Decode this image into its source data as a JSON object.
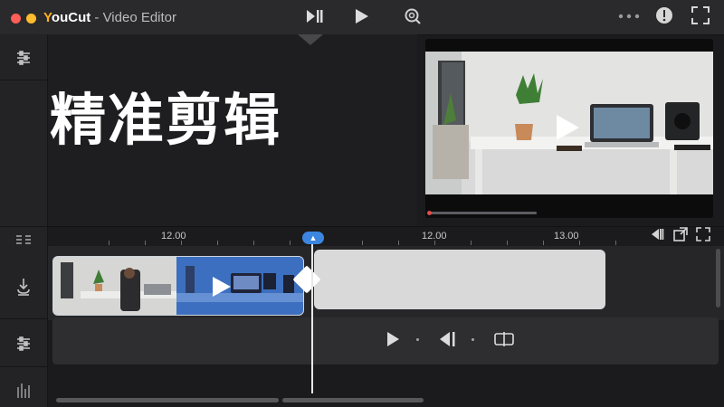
{
  "window": {
    "app_name_y": "Y",
    "app_name_rest": "ouCut",
    "separator": " - ",
    "title": "Video Editor"
  },
  "colors": {
    "close": "#ff5f57",
    "minimize": "#febc2e",
    "brand": "#ffb21c",
    "playhead": "#3c86e0",
    "selected_clip": "#3a6fd1",
    "background": "#1b1b1d"
  },
  "toolbar": {
    "icons": [
      "play-pause-icon",
      "play-icon",
      "magnifier-icon",
      "more-icon",
      "info-icon",
      "fullscreen-icon"
    ]
  },
  "canvas": {
    "overlay_text": "精准剪辑"
  },
  "timeline": {
    "labels": [
      "12.00",
      "12.00",
      "13.00"
    ]
  },
  "playback": {
    "progress": 0.38
  }
}
